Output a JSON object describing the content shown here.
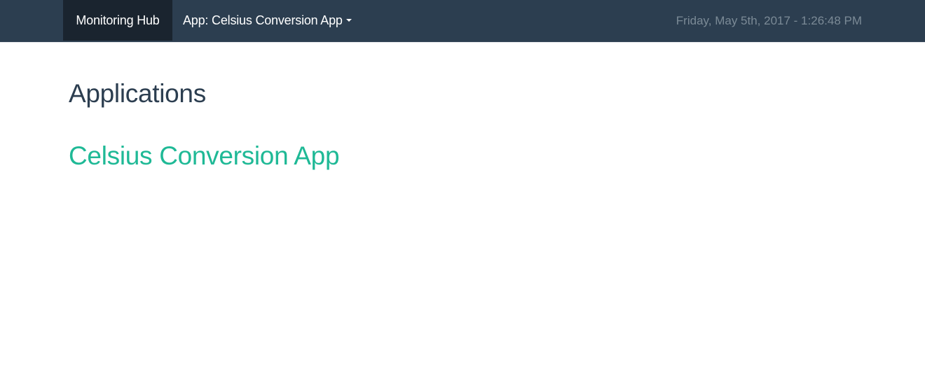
{
  "navbar": {
    "brand": "Monitoring Hub",
    "app_menu_label": "App: Celsius Conversion App",
    "datetime": "Friday, May 5th, 2017 - 1:26:48 PM"
  },
  "main": {
    "title": "Applications",
    "applications": [
      {
        "label": "Celsius Conversion App"
      }
    ]
  },
  "colors": {
    "navbar_bg": "#2c3e50",
    "brand_bg": "#1a242f",
    "link": "#1fb996",
    "heading": "#2c3e50",
    "date_text": "#7b8a96"
  },
  "icons": {
    "app_menu_caret": "chevron-down-icon"
  }
}
